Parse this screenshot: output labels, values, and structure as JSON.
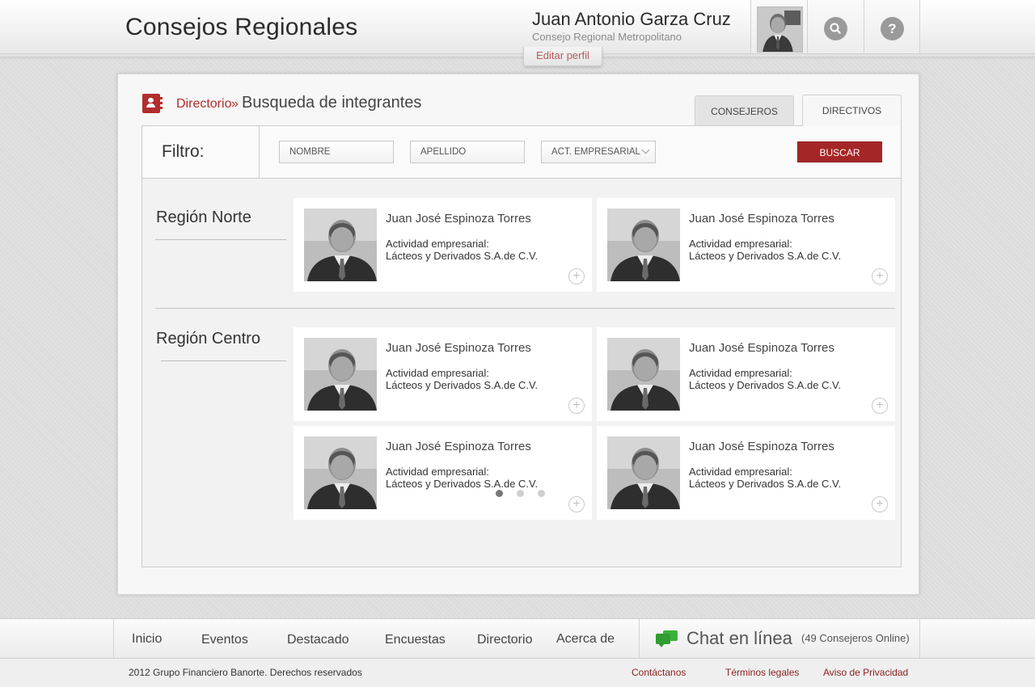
{
  "header": {
    "app_title": "Consejos Regionales",
    "user_name": "Juan Antonio Garza Cruz",
    "user_council": "Consejo Regional Metropolitano",
    "edit_profile": "Editar perfil",
    "search_icon": "search-icon",
    "help_glyph": "?"
  },
  "breadcrumb": {
    "link": "Directorio",
    "separator": "»",
    "current": "Busqueda de integrantes"
  },
  "tabs": [
    {
      "label": "CONSEJEROS",
      "active": false
    },
    {
      "label": "DIRECTIVOS",
      "active": true
    }
  ],
  "filter": {
    "label": "Filtro:",
    "nombre_placeholder": "NOMBRE",
    "apellido_placeholder": "APELLIDO",
    "act_selected": "ACT. EMPRESARIAL",
    "search_button": "BUSCAR"
  },
  "regions": [
    {
      "title": "Región Norte",
      "cards": [
        {
          "name": "Juan José Espinoza Torres",
          "act_label": "Actividad empresarial:",
          "act_value": "Lácteos y Derivados S.A.de C.V."
        },
        {
          "name": "Juan José Espinoza Torres",
          "act_label": "Actividad empresarial:",
          "act_value": "Lácteos y Derivados S.A.de C.V."
        }
      ]
    },
    {
      "title": "Región Centro",
      "cards": [
        {
          "name": "Juan José Espinoza Torres",
          "act_label": "Actividad empresarial:",
          "act_value": "Lácteos y Derivados S.A.de C.V."
        },
        {
          "name": "Juan José Espinoza Torres",
          "act_label": "Actividad empresarial:",
          "act_value": "Lácteos y Derivados S.A.de C.V."
        },
        {
          "name": "Juan José Espinoza Torres",
          "act_label": "Actividad empresarial:",
          "act_value": "Lácteos y Derivados S.A.de C.V."
        },
        {
          "name": "Juan José Espinoza Torres",
          "act_label": "Actividad empresarial:",
          "act_value": "Lácteos y Derivados S.A.de C.V."
        }
      ]
    }
  ],
  "pagination": {
    "total_pages": 3,
    "current_page": 1
  },
  "footer": {
    "nav": [
      "Inicio",
      "Eventos",
      "Destacado",
      "Encuestas",
      "Directorio",
      "Acerca de"
    ],
    "chat_label": "Chat en línea",
    "chat_online": "(49 Consejeros Online)",
    "copyright": "2012 Grupo Financiero Banorte. Derechos reservados",
    "links": [
      "Contáctanos",
      "Términos legales",
      "Aviso de Privacidad"
    ]
  },
  "colors": {
    "accent": "#a52626",
    "link_red": "#b22d2d",
    "chat_green": "#3bb33b"
  }
}
